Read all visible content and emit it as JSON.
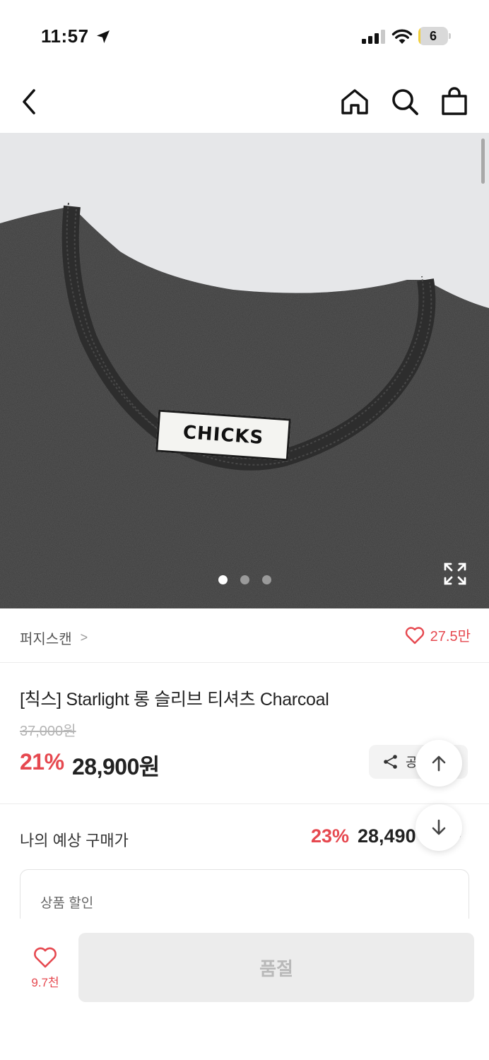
{
  "status_bar": {
    "time": "11:57",
    "battery_level": "6",
    "battery_percent": 6,
    "icons": [
      "location-arrow-icon",
      "cell-signal-icon",
      "wifi-icon",
      "battery-icon"
    ]
  },
  "nav": {
    "icons": [
      "back-chevron-icon",
      "home-icon",
      "search-icon",
      "shopping-bag-icon"
    ]
  },
  "gallery": {
    "label_text": "CHICKS",
    "image_count": 3,
    "active_index": 0,
    "icons": [
      "expand-icon"
    ]
  },
  "brand": {
    "name": "퍼지스캔",
    "chevron": ">",
    "like_count": "27.5만"
  },
  "product": {
    "title": "[칙스] Starlight 롱 슬리브 티셔츠 Charcoal",
    "original_price": "37,000원",
    "discount_rate": "21%",
    "sale_price": "28,900원",
    "share_label": "공"
  },
  "expected": {
    "label": "나의 예상 구매가",
    "rate": "23%",
    "price": "28,490",
    "chevron": "›"
  },
  "discount_box": {
    "label": "상품 할인"
  },
  "bottom": {
    "wish_count": "9.7천",
    "soldout_label": "품절"
  },
  "colors": {
    "accent_red": "#e6484f",
    "shirt": "#3a3a3a",
    "background_gray": "#e6e7e9",
    "battery_yellow": "#f2cf3a",
    "disabled_button": "#ececec"
  }
}
